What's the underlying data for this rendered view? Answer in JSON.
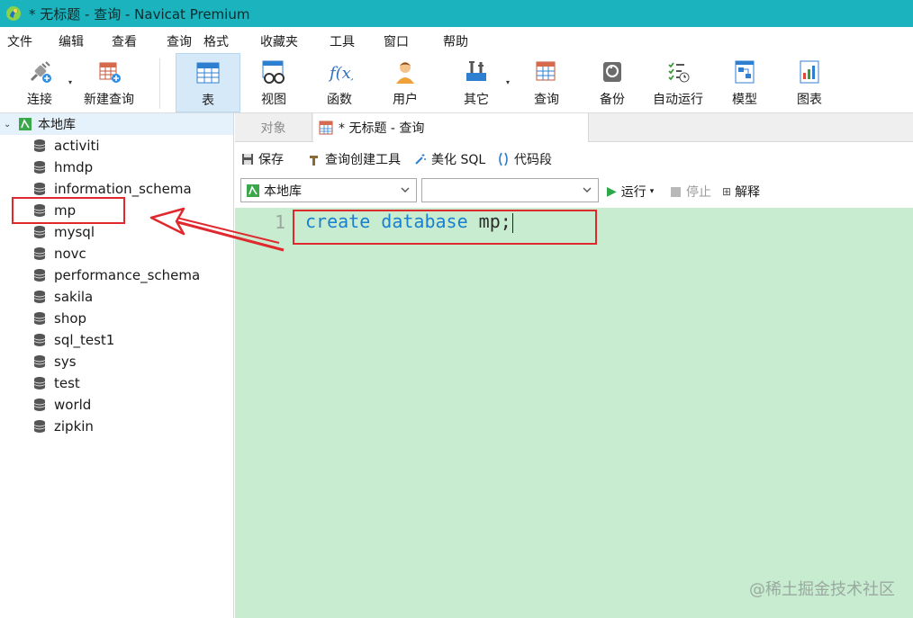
{
  "window": {
    "title": "* 无标题 - 查询 - Navicat Premium"
  },
  "menu": [
    "文件",
    "编辑",
    "查看",
    "查询",
    "格式",
    "收藏夹",
    "工具",
    "窗口",
    "帮助"
  ],
  "toolbar": {
    "connect": "连接",
    "new_query": "新建查询",
    "table": "表",
    "view": "视图",
    "function": "函数",
    "user": "用户",
    "other": "其它",
    "query": "查询",
    "backup": "备份",
    "autorun": "自动运行",
    "model": "模型",
    "chart": "图表"
  },
  "tree": {
    "root": "本地库",
    "databases": [
      "activiti",
      "hmdp",
      "information_schema",
      "mp",
      "mysql",
      "novc",
      "performance_schema",
      "sakila",
      "shop",
      "sql_test1",
      "sys",
      "test",
      "world",
      "zipkin"
    ]
  },
  "tabs": {
    "objects": "对象",
    "query": "* 无标题 - 查询"
  },
  "query_toolbar": {
    "save": "保存",
    "builder": "查询创建工具",
    "beautify": "美化 SQL",
    "snippet": "代码段"
  },
  "selectors": {
    "connection": "本地库",
    "database": ""
  },
  "run": {
    "run": "运行",
    "stop": "停止",
    "explain": "解释"
  },
  "editor": {
    "line_number": "1",
    "kw1": "create",
    "kw2": "database",
    "rest": "mp;"
  },
  "watermark": "@稀土掘金技术社区",
  "colors": {
    "titlebar": "#1bb3bd",
    "editor_bg": "#c8ecd0",
    "keyword": "#1a7fd0",
    "highlight": "#e0292e"
  }
}
